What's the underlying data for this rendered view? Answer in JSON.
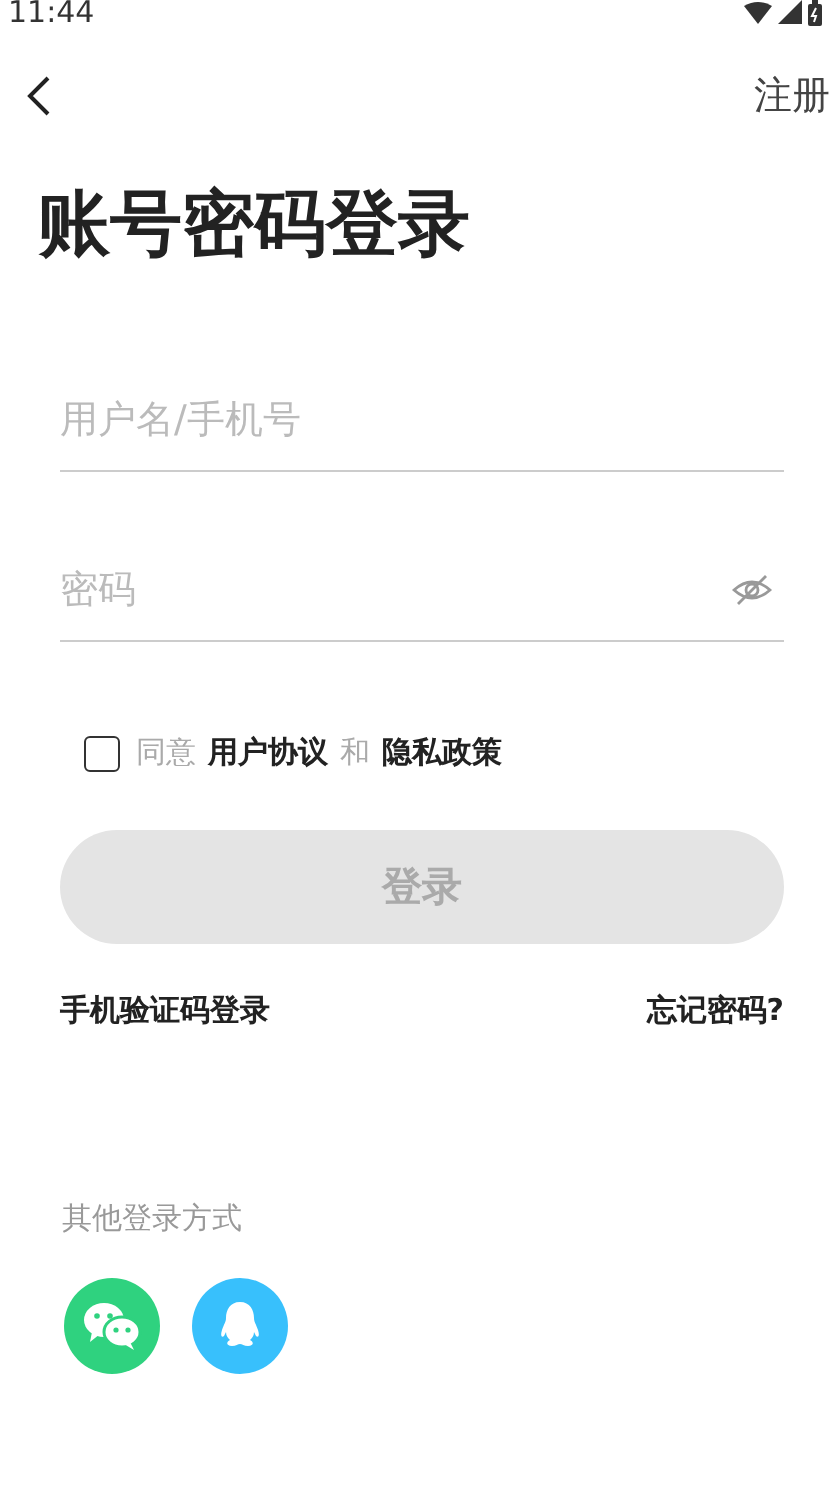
{
  "status_bar": {
    "time": "11:44"
  },
  "top_bar": {
    "action": "注册"
  },
  "title": "账号密码登录",
  "fields": [
    {
      "kind": "text",
      "placeholder": "用户名/手机号"
    },
    {
      "kind": "password",
      "placeholder": "密码",
      "show_password": false
    }
  ],
  "agreement": {
    "checked": false,
    "parts": [
      {
        "kind": "text",
        "text": "同意"
      },
      {
        "kind": "link",
        "text": "用户协议"
      },
      {
        "kind": "text",
        "text": "和"
      },
      {
        "kind": "link",
        "text": "隐私政策"
      }
    ]
  },
  "login_button": {
    "label": "登录",
    "disabled": true
  },
  "links": [
    "手机验证码登录",
    "忘记密码?"
  ],
  "other_login": {
    "label": "其他登录方式",
    "methods": [
      {
        "kind": "wechat"
      },
      {
        "kind": "qq"
      }
    ]
  }
}
